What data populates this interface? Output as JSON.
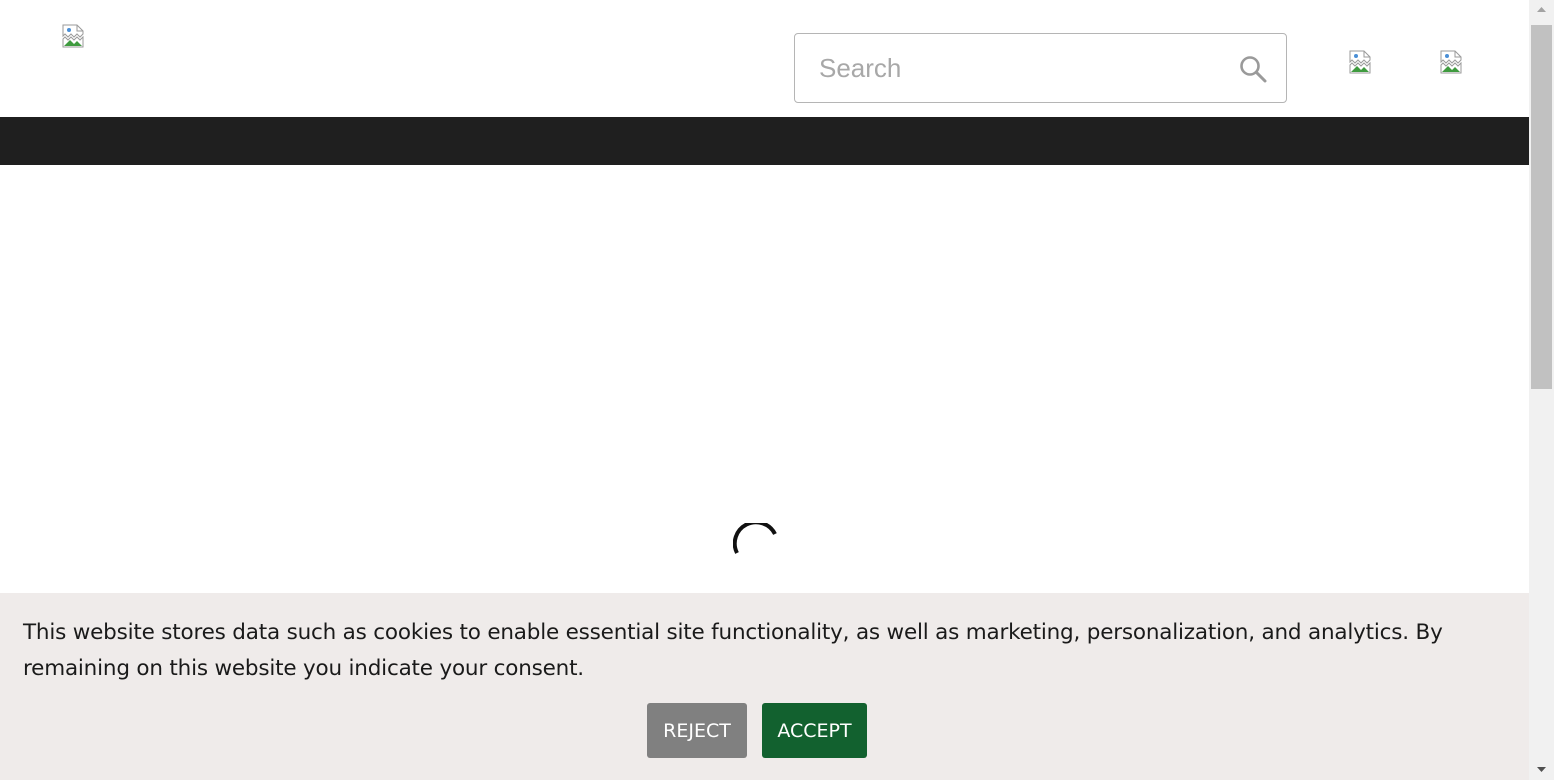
{
  "header": {
    "logo_alt": "",
    "search": {
      "placeholder": "Search",
      "value": ""
    },
    "icons": [
      "broken-image-icon",
      "broken-image-icon"
    ]
  },
  "main": {
    "state": "loading",
    "spinner_icon": "loading-spinner-icon"
  },
  "cookie_banner": {
    "message": "This website stores data such as cookies to enable essential site functionality, as well as marketing, personalization, and analytics. By remaining on this website you indicate your consent.",
    "reject_label": "REJECT",
    "accept_label": "ACCEPT",
    "colors": {
      "background": "#efebea",
      "reject": "#808080",
      "accept": "#12612f"
    }
  },
  "colors": {
    "navbar": "#1f1f1f",
    "search_border": "#b5b5b5",
    "placeholder": "#a8a8a8"
  },
  "scrollbar": {
    "position_fraction": 0.0
  }
}
